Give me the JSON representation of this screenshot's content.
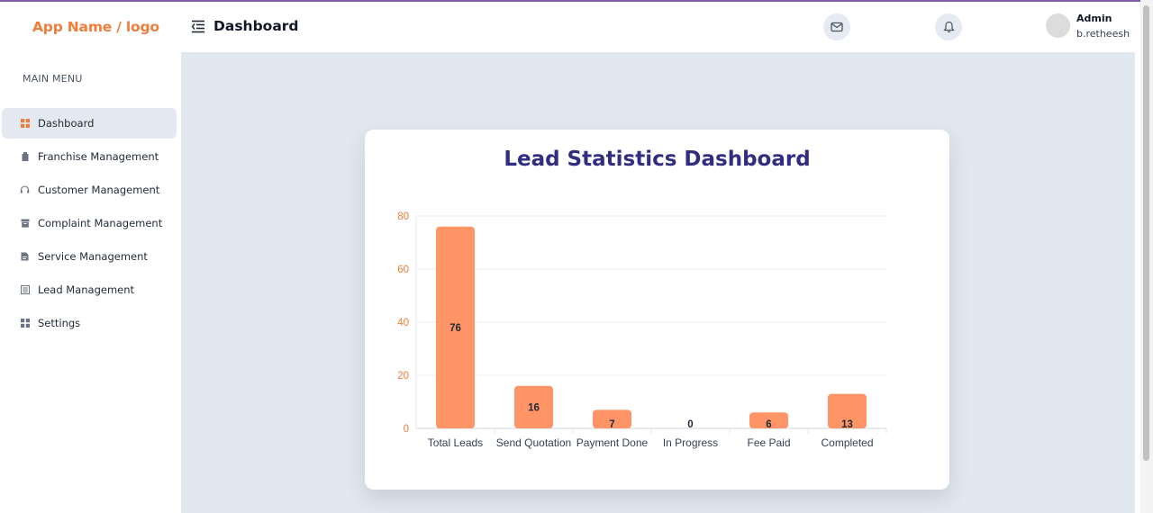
{
  "header": {
    "logo": "App Name / logo",
    "title": "Dashboard",
    "user": {
      "role": "Admin",
      "name": "b.retheesh"
    }
  },
  "sidebar": {
    "heading": "MAIN MENU",
    "items": [
      {
        "label": "Dashboard",
        "icon": "grid-icon",
        "active": true
      },
      {
        "label": "Franchise Management",
        "icon": "building-icon"
      },
      {
        "label": "Customer Management",
        "icon": "headset-icon"
      },
      {
        "label": "Complaint Management",
        "icon": "archive-icon"
      },
      {
        "label": "Service Management",
        "icon": "document-icon"
      },
      {
        "label": "Lead Management",
        "icon": "list-icon"
      },
      {
        "label": "Settings",
        "icon": "settings-grid-icon"
      }
    ]
  },
  "colors": {
    "accent": "#f07d3a",
    "bar": "#ff9466",
    "title": "#312e81",
    "main_bg": "#e2e8f0",
    "active_nav": "#e4e9f1"
  },
  "chart_data": {
    "type": "bar",
    "title": "Lead Statistics Dashboard",
    "categories": [
      "Total Leads",
      "Send Quotation",
      "Payment Done",
      "In Progress",
      "Fee Paid",
      "Completed"
    ],
    "values": [
      76,
      16,
      7,
      0,
      6,
      13
    ],
    "yticks": [
      0,
      20,
      40,
      60,
      80
    ],
    "ylim": [
      0,
      80
    ],
    "grid": true
  }
}
